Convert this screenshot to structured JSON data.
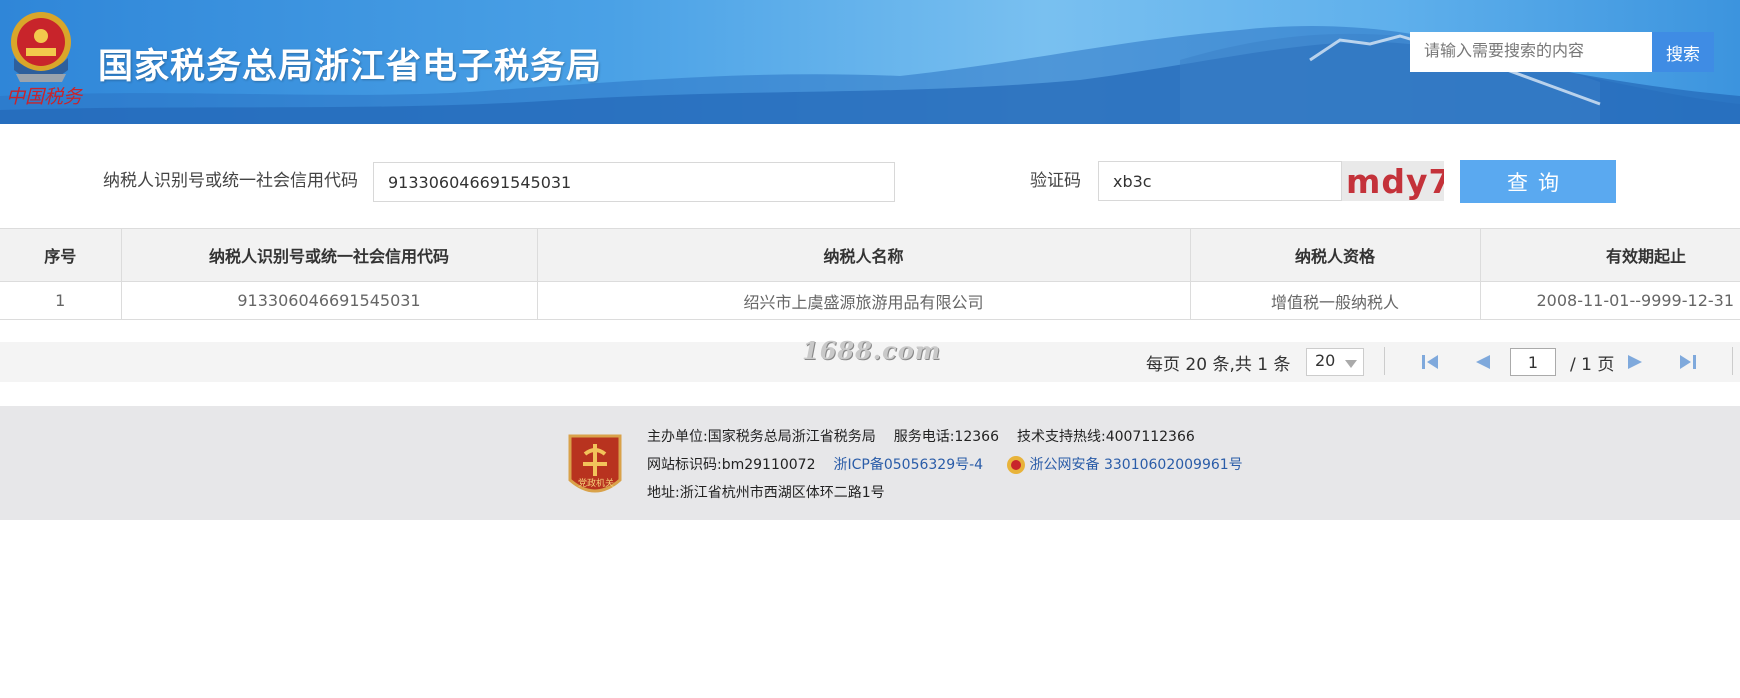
{
  "header": {
    "title": "国家税务总局浙江省电子税务局",
    "emblem_text": "中国税务",
    "search_placeholder": "请输入需要搜索的内容",
    "search_button": "搜索"
  },
  "query": {
    "taxpayer_id_label": "纳税人识别号或统一社会信用代码",
    "taxpayer_id_value": "913306046691545031",
    "captcha_label": "验证码",
    "captcha_value": "xb3c",
    "captcha_image_text": "mdy7",
    "query_button": "查询"
  },
  "table": {
    "headers": [
      "序号",
      "纳税人识别号或统一社会信用代码",
      "纳税人名称",
      "纳税人资格",
      "有效期起止"
    ],
    "rows": [
      [
        "1",
        "913306046691545031",
        "绍兴市上虞盛源旅游用品有限公司",
        "增值税一般纳税人",
        "2008-11-01--9999-12-31"
      ]
    ]
  },
  "watermark": "1688.com",
  "pager": {
    "info": "每页 20 条,共 1 条",
    "page_size": "20",
    "current_page": "1",
    "total": "/ 1 页"
  },
  "footer": {
    "badge_text": "党政机关",
    "host_label": "主办单位:",
    "host_value": "国家税务总局浙江省税务局",
    "service_phone": "服务电话:12366",
    "support_hotline": "技术支持热线:4007112366",
    "site_code": "网站标识码:bm29110072",
    "icp": "浙ICP备05056329号-4",
    "police_record": "浙公网安备 33010602009961号",
    "address": "地址:浙江省杭州市西湖区体环二路1号"
  },
  "colors": {
    "header_blue": "#3f8ce4",
    "query_button": "#5aa9f0",
    "footer_bg": "#e7e7e9",
    "link": "#2a5ca8",
    "captcha_text": "#c4323a"
  }
}
